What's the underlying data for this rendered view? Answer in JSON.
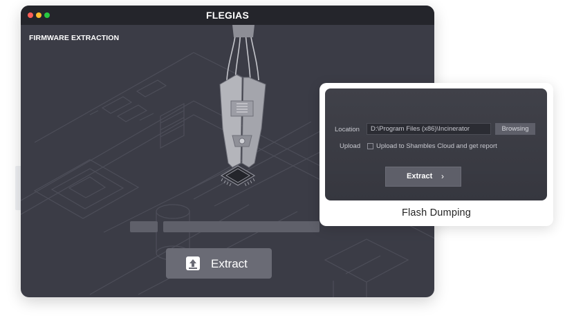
{
  "window": {
    "title": "FLEGIAS",
    "section_label": "FIRMWARE EXTRACTION"
  },
  "main": {
    "extract_label": "Extract",
    "extract_icon": "upload-icon"
  },
  "card": {
    "caption": "Flash Dumping",
    "location_label": "Location",
    "location_value": "D:\\Program Files (x86)\\Incinerator",
    "browse_label": "Browsing",
    "upload_label": "Upload",
    "upload_checkbox_text": "Upload to Shambles Cloud and get report",
    "upload_checked": false,
    "extract_label": "Extract",
    "extract_chevron": "›"
  },
  "colors": {
    "window_bg": "#3b3c46",
    "titlebar_bg": "#24252b",
    "close": "#ff5f57",
    "minimize": "#febc2e",
    "maximize": "#28c840",
    "button_bg": "#6a6b75"
  }
}
